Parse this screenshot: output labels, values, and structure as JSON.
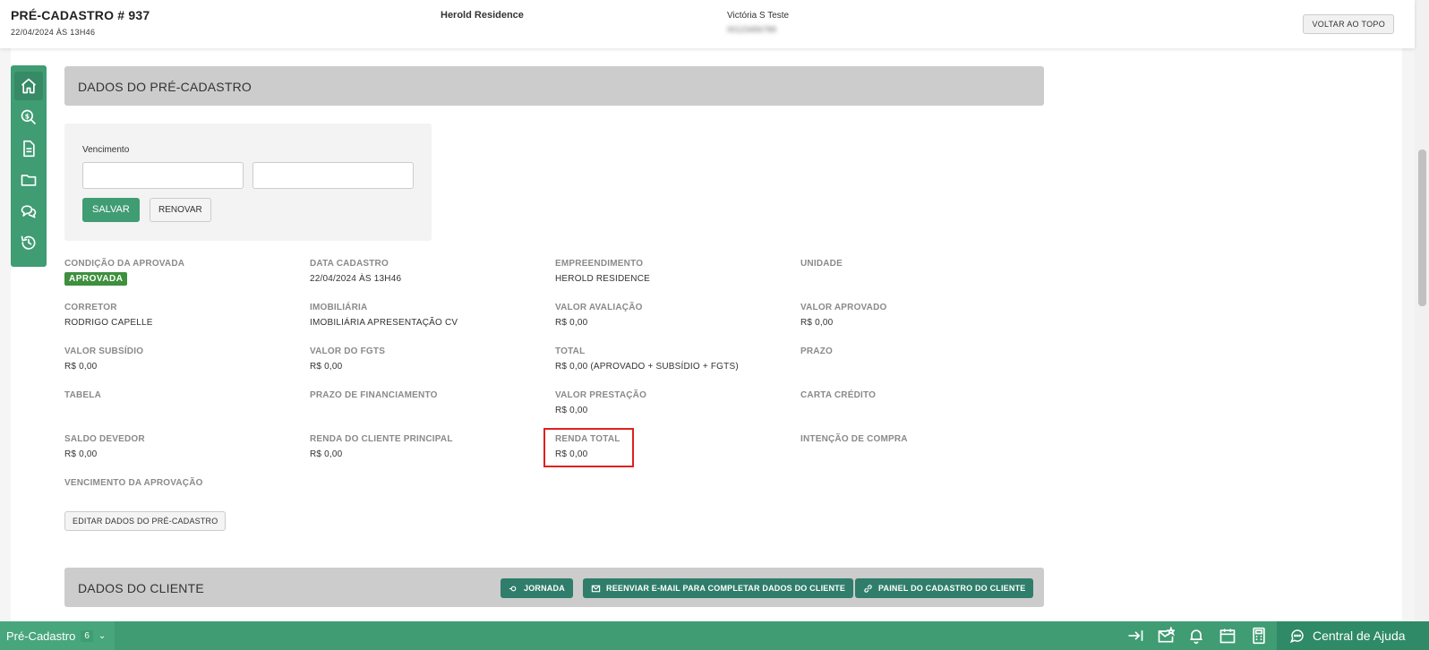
{
  "header": {
    "title": "PRÉ-CADASTRO # 937",
    "datetime": "22/04/2024 ÀS 13H46",
    "empreendimento": "Herold Residence",
    "client_name": "Victória S Teste",
    "client_phone": "00123456789",
    "back_to_top_label": "VOLTAR AO TOPO"
  },
  "sidebar": {
    "items": [
      {
        "icon": "home-icon"
      },
      {
        "icon": "search-money-icon"
      },
      {
        "icon": "document-icon"
      },
      {
        "icon": "folder-icon"
      },
      {
        "icon": "chat-icon"
      },
      {
        "icon": "history-icon"
      }
    ]
  },
  "pre_cadastro": {
    "section_title": "DADOS DO PRÉ-CADASTRO",
    "vencimento_label": "Vencimento",
    "vencimento_value_1": "",
    "vencimento_value_2": "",
    "salvar_label": "SALVAR",
    "renovar_label": "RENOVAR",
    "fields": {
      "condicao_label": "CONDIÇÃO DA APROVADA",
      "condicao_value": "APROVADA",
      "data_cadastro_label": "DATA CADASTRO",
      "data_cadastro_value": "22/04/2024 ÀS 13H46",
      "empreendimento_label": "EMPREENDIMENTO",
      "empreendimento_value": "HEROLD RESIDENCE",
      "unidade_label": "UNIDADE",
      "corretor_label": "CORRETOR",
      "corretor_value": "RODRIGO CAPELLE",
      "imobiliaria_label": "IMOBILIÁRIA",
      "imobiliaria_value": "IMOBILIÁRIA APRESENTAÇÃO CV",
      "valor_avaliacao_label": "VALOR AVALIAÇÃO",
      "valor_avaliacao_value": "R$ 0,00",
      "valor_aprovado_label": "VALOR APROVADO",
      "valor_aprovado_value": "R$ 0,00",
      "valor_subsidio_label": "VALOR SUBSÍDIO",
      "valor_subsidio_value": "R$ 0,00",
      "valor_fgts_label": "VALOR DO FGTS",
      "valor_fgts_value": "R$ 0,00",
      "total_label": "TOTAL",
      "total_value": "R$ 0,00 (APROVADO + SUBSÍDIO + FGTS)",
      "prazo_label": "PRAZO",
      "tabela_label": "TABELA",
      "prazo_financiamento_label": "PRAZO DE FINANCIAMENTO",
      "valor_prestacao_label": "VALOR PRESTAÇÃO",
      "valor_prestacao_value": "R$ 0,00",
      "carta_credito_label": "CARTA CRÉDITO",
      "saldo_devedor_label": "SALDO DEVEDOR",
      "saldo_devedor_value": "R$ 0,00",
      "renda_cliente_label": "RENDA DO CLIENTE PRINCIPAL",
      "renda_cliente_value": "R$ 0,00",
      "renda_total_label": "RENDA TOTAL",
      "renda_total_value": "R$ 0,00",
      "intencao_label": "INTENÇÃO DE COMPRA",
      "vencimento_aprovacao_label": "VENCIMENTO DA APROVAÇÃO"
    },
    "edit_label": "EDITAR DADOS DO PRÉ-CADASTRO"
  },
  "cliente": {
    "section_title": "DADOS DO CLIENTE",
    "jornada_label": "JORNADA",
    "reenviar_label": "REENVIAR E-MAIL PARA COMPLETAR DADOS DO CLIENTE",
    "painel_label": "PAINEL DO CADASTRO DO CLIENTE"
  },
  "bottombar": {
    "pre_cadastro_label": "Pré-Cadastro",
    "pre_cadastro_count": "6",
    "help_label": "Central de Ajuda"
  },
  "colors": {
    "brand_green": "#3f9c73",
    "dark_teal": "#2f7d6a",
    "approved_badge": "#3e8f3e",
    "highlight_red": "#e02020"
  }
}
